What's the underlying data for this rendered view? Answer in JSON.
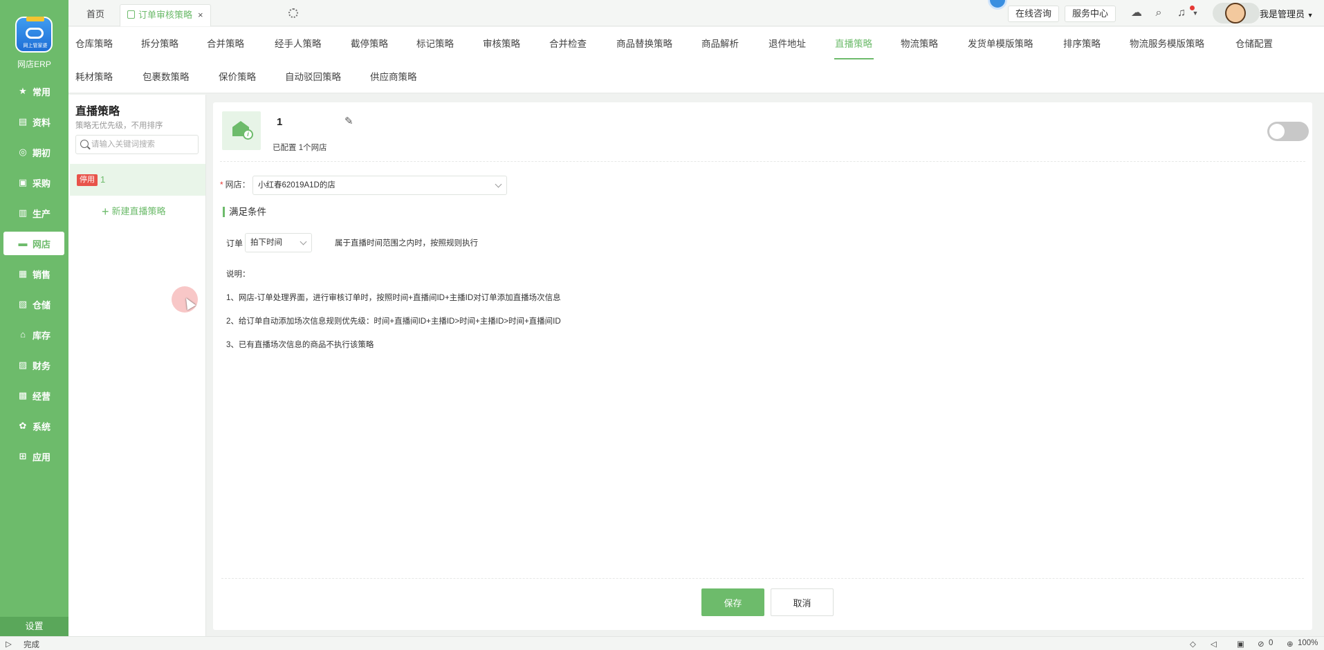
{
  "sidebar": {
    "brand": "网店ERP",
    "logo_text": "网上管家婆",
    "items": [
      {
        "label": "常用",
        "icon": "star-icon"
      },
      {
        "label": "资料",
        "icon": "document-icon"
      },
      {
        "label": "期初",
        "icon": "target-icon"
      },
      {
        "label": "采购",
        "icon": "cart-icon"
      },
      {
        "label": "生产",
        "icon": "factory-icon"
      },
      {
        "label": "网店",
        "icon": "store-icon"
      },
      {
        "label": "销售",
        "icon": "chart-icon"
      },
      {
        "label": "仓储",
        "icon": "warehouse-icon"
      },
      {
        "label": "库存",
        "icon": "box-icon"
      },
      {
        "label": "财务",
        "icon": "ledger-icon"
      },
      {
        "label": "经营",
        "icon": "briefcase-icon"
      },
      {
        "label": "系统",
        "icon": "gear-icon"
      },
      {
        "label": "应用",
        "icon": "plus-square-icon"
      }
    ],
    "active": "网店",
    "settings": "设置"
  },
  "tabs": {
    "home": "首页",
    "active": "订单审核策略",
    "close": "×"
  },
  "header": {
    "online_consult": "在线咨询",
    "service_center": "服务中心",
    "user_name": "我是管理员"
  },
  "menu": {
    "row1": [
      "仓库策略",
      "拆分策略",
      "合并策略",
      "经手人策略",
      "截停策略",
      "标记策略",
      "审核策略",
      "合并检查",
      "商品替换策略",
      "商品解析",
      "退件地址",
      "直播策略",
      "物流策略",
      "发货单模版策略",
      "排序策略",
      "物流服务模版策略",
      "仓储配置"
    ],
    "row2": [
      "耗材策略",
      "包裹数策略",
      "保价策略",
      "自动驳回策略",
      "供应商策略"
    ],
    "active": "直播策略"
  },
  "list": {
    "title": "直播策略",
    "subtitle": "策略无优先级，不用排序",
    "search_placeholder": "请输入关键词搜索",
    "items": [
      {
        "badge": "停用",
        "name": "1"
      }
    ],
    "add_new": "新建直播策略"
  },
  "detail": {
    "name": "1",
    "configured": "已配置  1个网店",
    "shop_label": "网店：",
    "shop_value": "小红春62019A1D的店",
    "section_title": "满足条件",
    "cond_pre": "订单",
    "cond_select": "拍下时间",
    "cond_post": "属于直播时间范围之内时，按照规则执行",
    "notes_title": "说明：",
    "notes": [
      "1、网店-订单处理界面，进行审核订单时，按照时间+直播间ID+主播ID对订单添加直播场次信息",
      "2、给订单自动添加场次信息规则优先级：时间+直播间ID+主播ID>时间+主播ID>时间+直播间ID",
      "3、已有直播场次信息的商品不执行该策略"
    ],
    "save": "保存",
    "cancel": "取消",
    "enabled": false
  },
  "status": {
    "left": "完成",
    "count": "0",
    "zoom": "100%"
  },
  "colors": {
    "accent": "#6dbb6b",
    "badge": "#e8534a"
  }
}
